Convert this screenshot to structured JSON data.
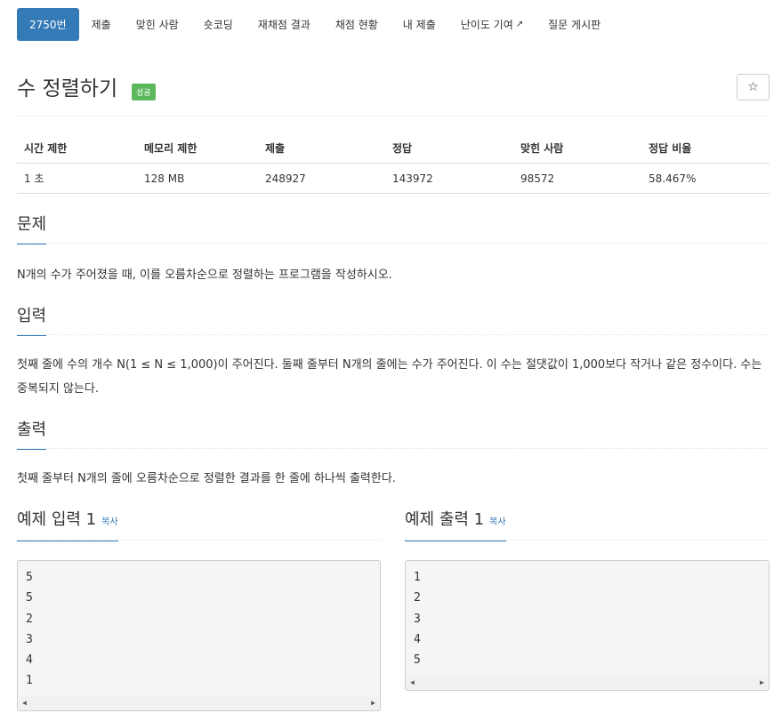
{
  "tabs": [
    {
      "label": "2750번",
      "active": true
    },
    {
      "label": "제출"
    },
    {
      "label": "맞힌 사람"
    },
    {
      "label": "숏코딩"
    },
    {
      "label": "재채점 결과"
    },
    {
      "label": "채점 현황"
    },
    {
      "label": "내 제출"
    },
    {
      "label": "난이도 기여",
      "external": true
    },
    {
      "label": "질문 게시판"
    }
  ],
  "problem": {
    "title": "수 정렬하기",
    "status_badge": "성공",
    "star_icon": "☆"
  },
  "info_table": {
    "headers": [
      "시간 제한",
      "메모리 제한",
      "제출",
      "정답",
      "맞힌 사람",
      "정답 비율"
    ],
    "values": [
      "1 초",
      "128 MB",
      "248927",
      "143972",
      "98572",
      "58.467%"
    ]
  },
  "sections": {
    "problem": {
      "heading": "문제",
      "text": "N개의 수가 주어졌을 때, 이를 오름차순으로 정렬하는 프로그램을 작성하시오."
    },
    "input": {
      "heading": "입력",
      "text": "첫째 줄에 수의 개수 N(1 ≤ N ≤ 1,000)이 주어진다. 둘째 줄부터 N개의 줄에는 수가 주어진다. 이 수는 절댓값이 1,000보다 작거나 같은 정수이다. 수는 중복되지 않는다."
    },
    "output": {
      "heading": "출력",
      "text": "첫째 줄부터 N개의 줄에 오름차순으로 정렬한 결과를 한 줄에 하나씩 출력한다."
    }
  },
  "samples": {
    "input": {
      "heading": "예제 입력 1",
      "copy_label": "복사",
      "content": "5\n5\n2\n3\n4\n1"
    },
    "output": {
      "heading": "예제 출력 1",
      "copy_label": "복사",
      "content": "1\n2\n3\n4\n5"
    }
  },
  "accent_color": "#337ab7",
  "badge_color": "#5cb85c"
}
